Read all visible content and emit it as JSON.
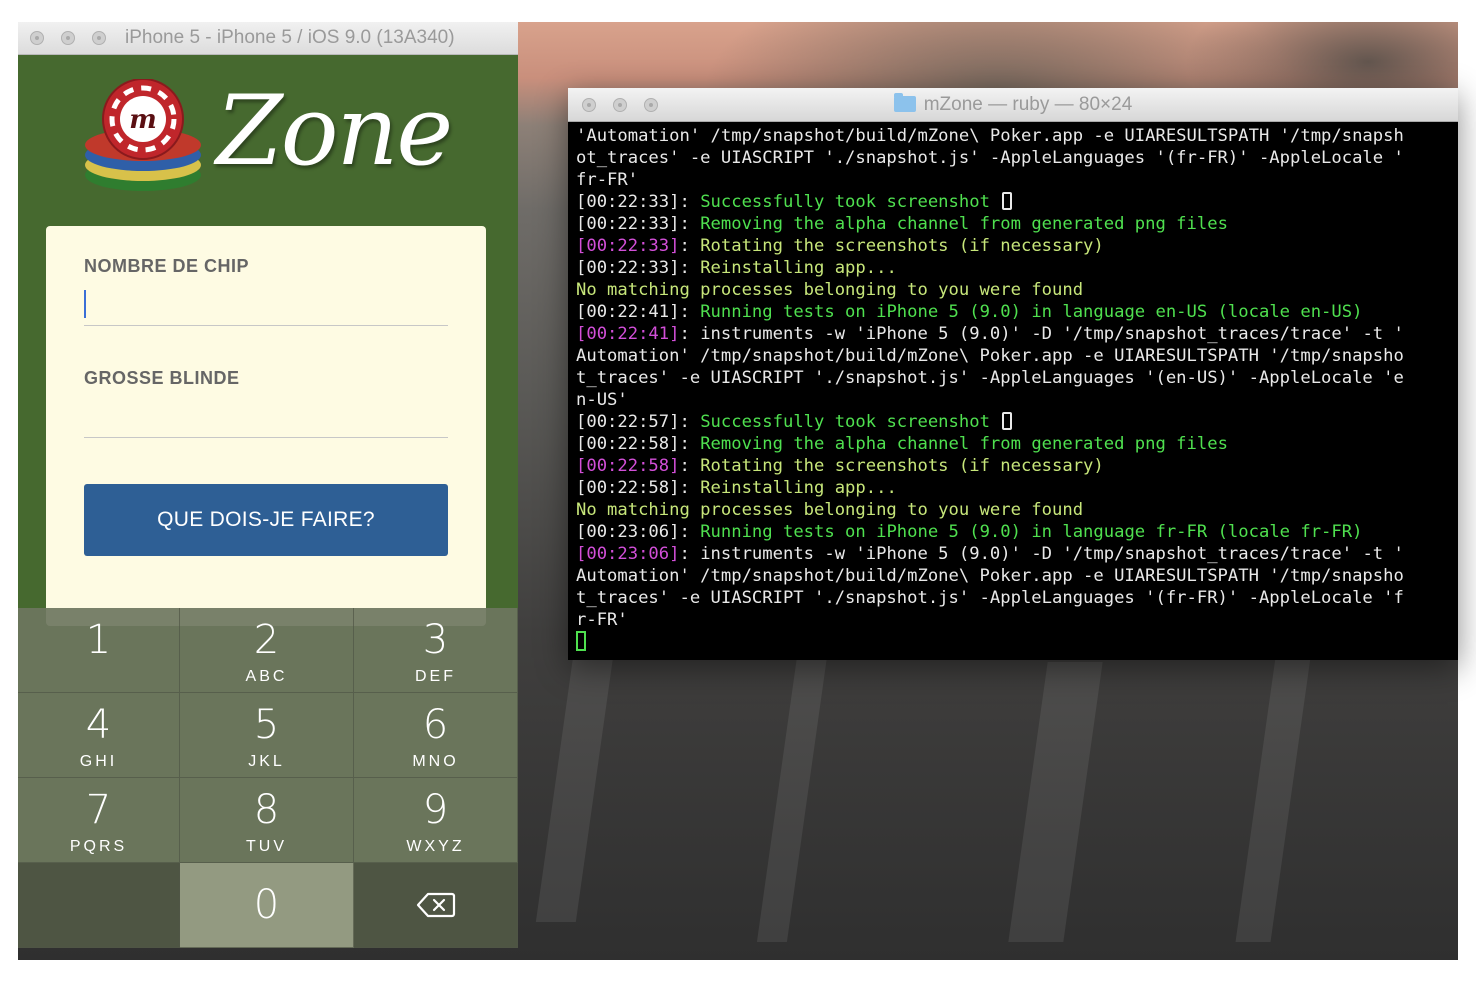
{
  "simulator": {
    "title": "iPhone 5 - iPhone 5 / iOS 9.0 (13A340)",
    "app": {
      "logo_letter": "m",
      "logo_word": "Zone",
      "field1_label": "NOMBRE DE CHIP",
      "field1_value": "",
      "field2_label": "GROSSE BLINDE",
      "field2_value": "",
      "cta_label": "QUE DOIS-JE FAIRE?"
    },
    "keypad": [
      {
        "num": "1",
        "letters": ""
      },
      {
        "num": "2",
        "letters": "ABC"
      },
      {
        "num": "3",
        "letters": "DEF"
      },
      {
        "num": "4",
        "letters": "GHI"
      },
      {
        "num": "5",
        "letters": "JKL"
      },
      {
        "num": "6",
        "letters": "MNO"
      },
      {
        "num": "7",
        "letters": "PQRS"
      },
      {
        "num": "8",
        "letters": "TUV"
      },
      {
        "num": "9",
        "letters": "WXYZ"
      },
      {
        "num": "0",
        "letters": ""
      }
    ],
    "colors": {
      "app_bg": "#46692f",
      "card_bg": "#fefbe3",
      "cta_bg": "#2e5f95"
    }
  },
  "terminal": {
    "title": "mZone — ruby — 80×24",
    "lines": [
      [
        {
          "t": "'Automation' /tmp/snapshot/build/mZone\\ Poker.app -e UIARESULTSPATH '/tmp/snapsh",
          "c": "white"
        }
      ],
      [
        {
          "t": "ot_traces' -e UIASCRIPT './snapshot.js' -AppleLanguages '(fr-FR)' -AppleLocale '",
          "c": "white"
        }
      ],
      [
        {
          "t": "fr-FR'",
          "c": "white"
        }
      ],
      [
        {
          "t": "[00:22:33]",
          "c": "ts-w"
        },
        {
          "t": ": ",
          "c": "white"
        },
        {
          "t": "Successfully took screenshot ",
          "c": "green"
        },
        {
          "t": "PHONE",
          "c": "icon"
        }
      ],
      [
        {
          "t": "[00:22:33]",
          "c": "ts-w"
        },
        {
          "t": ": ",
          "c": "white"
        },
        {
          "t": "Removing the alpha channel from generated png files",
          "c": "green"
        }
      ],
      [
        {
          "t": "[00:22:33]",
          "c": "ts-m"
        },
        {
          "t": ": ",
          "c": "white"
        },
        {
          "t": "Rotating the screenshots (if necessary)",
          "c": "yellow"
        }
      ],
      [
        {
          "t": "[00:22:33]",
          "c": "ts-w"
        },
        {
          "t": ": ",
          "c": "white"
        },
        {
          "t": "Reinstalling app...",
          "c": "yellow"
        }
      ],
      [
        {
          "t": "No matching processes belonging to you were found",
          "c": "yellow"
        }
      ],
      [
        {
          "t": "[00:22:41]",
          "c": "ts-w"
        },
        {
          "t": ": ",
          "c": "white"
        },
        {
          "t": "Running tests on iPhone 5 (9.0) in language en-US (locale en-US)",
          "c": "green"
        }
      ],
      [
        {
          "t": "[00:22:41]",
          "c": "ts-m"
        },
        {
          "t": ": ",
          "c": "white"
        },
        {
          "t": "instruments -w 'iPhone 5 (9.0)' -D '/tmp/snapshot_traces/trace' -t '",
          "c": "white"
        }
      ],
      [
        {
          "t": "Automation' /tmp/snapshot/build/mZone\\ Poker.app -e UIARESULTSPATH '/tmp/snapsho",
          "c": "white"
        }
      ],
      [
        {
          "t": "t_traces' -e UIASCRIPT './snapshot.js' -AppleLanguages '(en-US)' -AppleLocale 'e",
          "c": "white"
        }
      ],
      [
        {
          "t": "n-US'",
          "c": "white"
        }
      ],
      [
        {
          "t": "[00:22:57]",
          "c": "ts-w"
        },
        {
          "t": ": ",
          "c": "white"
        },
        {
          "t": "Successfully took screenshot ",
          "c": "green"
        },
        {
          "t": "PHONE",
          "c": "icon"
        }
      ],
      [
        {
          "t": "[00:22:58]",
          "c": "ts-w"
        },
        {
          "t": ": ",
          "c": "white"
        },
        {
          "t": "Removing the alpha channel from generated png files",
          "c": "green"
        }
      ],
      [
        {
          "t": "[00:22:58]",
          "c": "ts-m"
        },
        {
          "t": ": ",
          "c": "white"
        },
        {
          "t": "Rotating the screenshots (if necessary)",
          "c": "yellow"
        }
      ],
      [
        {
          "t": "[00:22:58]",
          "c": "ts-w"
        },
        {
          "t": ": ",
          "c": "white"
        },
        {
          "t": "Reinstalling app...",
          "c": "yellow"
        }
      ],
      [
        {
          "t": "No matching processes belonging to you were found",
          "c": "yellow"
        }
      ],
      [
        {
          "t": "[00:23:06]",
          "c": "ts-w"
        },
        {
          "t": ": ",
          "c": "white"
        },
        {
          "t": "Running tests on iPhone 5 (9.0) in language fr-FR (locale fr-FR)",
          "c": "green"
        }
      ],
      [
        {
          "t": "[00:23:06]",
          "c": "ts-m"
        },
        {
          "t": ": ",
          "c": "white"
        },
        {
          "t": "instruments -w 'iPhone 5 (9.0)' -D '/tmp/snapshot_traces/trace' -t '",
          "c": "white"
        }
      ],
      [
        {
          "t": "Automation' /tmp/snapshot/build/mZone\\ Poker.app -e UIARESULTSPATH '/tmp/snapsho",
          "c": "white"
        }
      ],
      [
        {
          "t": "t_traces' -e UIASCRIPT './snapshot.js' -AppleLanguages '(fr-FR)' -AppleLocale 'f",
          "c": "white"
        }
      ],
      [
        {
          "t": "r-FR'",
          "c": "white"
        }
      ],
      [
        {
          "t": "CURSOR",
          "c": "cursor"
        }
      ]
    ]
  }
}
